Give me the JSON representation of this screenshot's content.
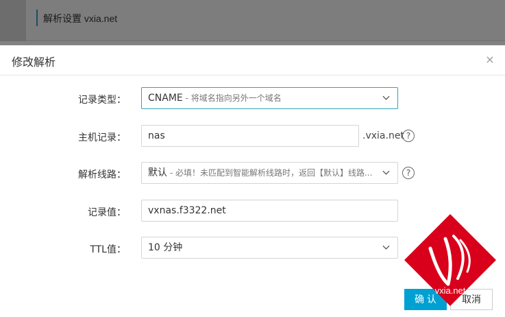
{
  "background": {
    "title": "解析设置 vxia.net"
  },
  "dialog": {
    "title": "修改解析",
    "close_icon": "×",
    "fields": {
      "record_type": {
        "label": "记录类型：",
        "value": "CNAME",
        "hint": " - 将域名指向另外一个域名"
      },
      "host": {
        "label": "主机记录：",
        "value": "nas",
        "suffix": ".vxia.net",
        "help": "?"
      },
      "line": {
        "label": "解析线路：",
        "value": "默认",
        "hint": " - 必填！未匹配到智能解析线路时，返回【默认】线路...",
        "help": "?"
      },
      "record_value": {
        "label": "记录值：",
        "value": "vxnas.f3322.net"
      },
      "ttl": {
        "label": "TTL值：",
        "value": "10 分钟"
      }
    },
    "ok_label": "确 认",
    "cancel_label": "取消"
  },
  "watermark": {
    "text": "vxia.net",
    "color": "#d9001b"
  },
  "colors": {
    "accent": "#00a0d2",
    "focus_border": "#2fa4b4"
  }
}
